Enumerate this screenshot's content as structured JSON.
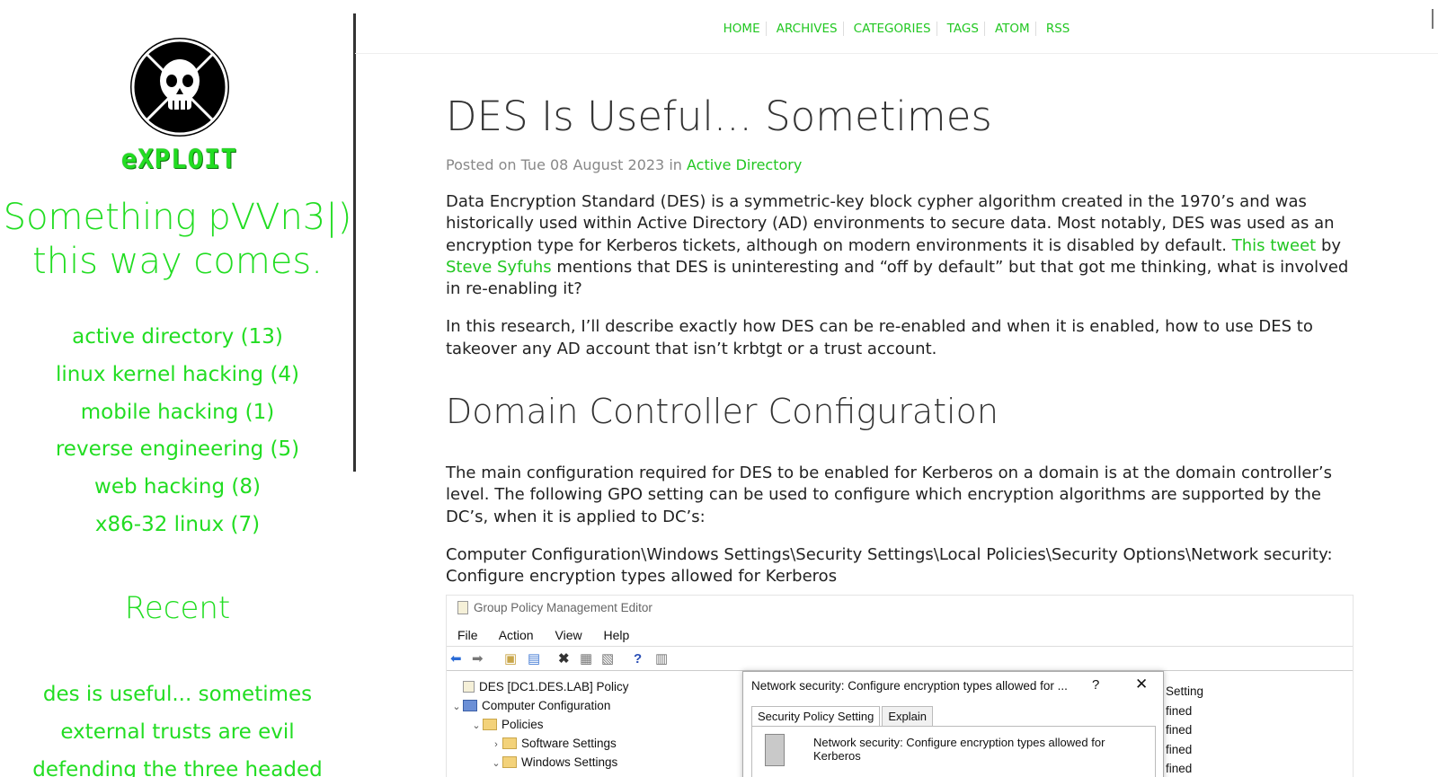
{
  "sidebar": {
    "logo_text": "eXPLOIT",
    "tagline": [
      "Something pVVn3|)",
      "this way comes."
    ],
    "categories": [
      "active directory (13)",
      "linux kernel hacking (4)",
      "mobile hacking (1)",
      "reverse engineering (5)",
      "web hacking (8)",
      "x86-32 linux (7)"
    ],
    "recent_heading": "Recent",
    "recent": [
      "des is useful... sometimes",
      "external trusts are evil",
      "defending the three headed"
    ]
  },
  "nav": [
    "HOME",
    "ARCHIVES",
    "CATEGORIES",
    "TAGS",
    "ATOM",
    "RSS"
  ],
  "article": {
    "title": "DES Is Useful... Sometimes",
    "meta_prefix": "Posted on Tue 08 August 2023 in",
    "meta_category": "Active Directory",
    "p1_a": "Data Encryption Standard (DES) is a symmetric-key block cypher algorithm created in the 1970’s and was historically used within Active Directory (AD) environments to secure data. Most notably, DES was used as an encryption type for Kerberos tickets, although on modern environments it is disabled by default.",
    "p1_link1": "This tweet",
    "p1_by": "by",
    "p1_link2": "Steve Syfuhs",
    "p1_b": "mentions that DES is uninteresting and “off by default” but that got me thinking, what is involved in re-enabling it?",
    "p2": "In this research, I’ll describe exactly how DES can be re-enabled and when it is enabled, how to use DES to takeover any AD account that isn’t krbtgt or a trust account.",
    "h2": "Domain Controller Configuration",
    "p3": "The main configuration required for DES to be enabled for Kerberos on a domain is at the domain controller’s level. The following GPO setting can be used to configure which encryption algorithms are supported by the DC’s, when it is applied to DC’s:",
    "p4": "Computer Configuration\\Windows Settings\\Security Settings\\Local Policies\\Security Options\\Network security: Configure encryption types allowed for Kerberos"
  },
  "screenshot": {
    "title": "Group Policy Management Editor",
    "menu": [
      "File",
      "Action",
      "View",
      "Help"
    ],
    "tree": [
      {
        "label": "DES [DC1.DES.LAB] Policy",
        "chev": "",
        "icon": "doc",
        "indent": 0
      },
      {
        "label": "Computer Configuration",
        "chev": "v",
        "icon": "pc",
        "indent": 0
      },
      {
        "label": "Policies",
        "chev": "v",
        "icon": "folder",
        "indent": 1
      },
      {
        "label": "Software Settings",
        "chev": ">",
        "icon": "folder",
        "indent": 2
      },
      {
        "label": "Windows Settings",
        "chev": "v",
        "icon": "folder",
        "indent": 2
      }
    ],
    "dialog_title": "Network security: Configure encryption types allowed for ...",
    "dialog_help": "?",
    "dialog_close": "✕",
    "dialog_tabs": [
      "Security Policy Setting",
      "Explain"
    ],
    "dialog_policy": "Network security: Configure encryption types allowed for Kerberos",
    "right_header": "Setting",
    "right_rows": [
      "fined",
      "fined",
      "fined",
      "fined"
    ]
  },
  "colors": {
    "accent": "#22dd22",
    "link": "#22c722"
  }
}
